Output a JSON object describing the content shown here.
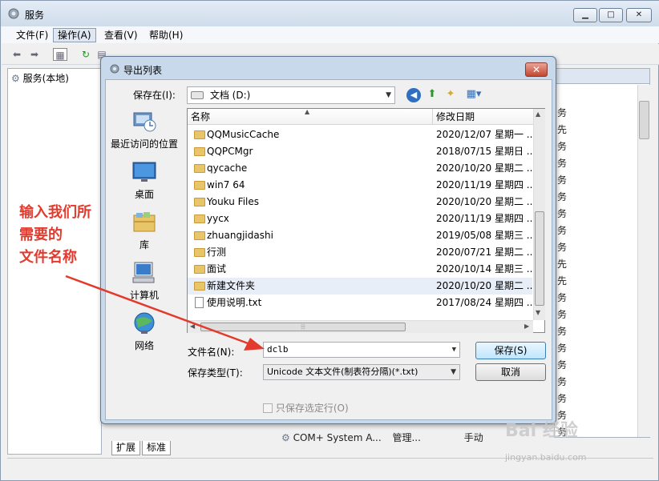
{
  "main_window": {
    "title": "服务",
    "controls": {
      "minimize": "▁",
      "maximize": "□",
      "close": "✕"
    },
    "menu": [
      "文件(F)",
      "操作(A)",
      "查看(V)",
      "帮助(H)"
    ],
    "active_menu_index": 1,
    "tree_item": "服务(本地)",
    "right_column_chars": [
      "务",
      "先",
      "务",
      "务",
      "务",
      "务",
      "务",
      "务",
      "务",
      "先",
      "先",
      "务",
      "务",
      "务",
      "务",
      "务",
      "务",
      "务",
      "务",
      "务"
    ],
    "bottom_tabs": [
      "扩展",
      "标准"
    ],
    "partial_row": {
      "name": "COM+ System A...",
      "desc": "管理...",
      "startup": "手动"
    }
  },
  "dialog": {
    "title": "导出列表",
    "close": "✕",
    "save_in_label": "保存在(I):",
    "save_in_value": "文档 (D:)",
    "places": [
      {
        "label": "最近访问的位置",
        "icon": "recent-places-icon"
      },
      {
        "label": "桌面",
        "icon": "desktop-icon"
      },
      {
        "label": "库",
        "icon": "library-icon"
      },
      {
        "label": "计算机",
        "icon": "computer-icon"
      },
      {
        "label": "网络",
        "icon": "network-icon"
      }
    ],
    "columns": {
      "name": "名称",
      "date": "修改日期"
    },
    "files": [
      {
        "name": "QQMusicCache",
        "date": "2020/12/07 星期一 ...",
        "type": "folder"
      },
      {
        "name": "QQPCMgr",
        "date": "2018/07/15 星期日 ...",
        "type": "folder"
      },
      {
        "name": "qycache",
        "date": "2020/10/20 星期二 ...",
        "type": "folder"
      },
      {
        "name": "win7 64",
        "date": "2020/11/19 星期四 ...",
        "type": "folder"
      },
      {
        "name": "Youku Files",
        "date": "2020/10/20 星期二 ...",
        "type": "folder"
      },
      {
        "name": "yycx",
        "date": "2020/11/19 星期四 ...",
        "type": "folder"
      },
      {
        "name": "zhuangjidashi",
        "date": "2019/05/08 星期三 ...",
        "type": "folder"
      },
      {
        "name": "行测",
        "date": "2020/07/21 星期二 ...",
        "type": "folder"
      },
      {
        "name": "面试",
        "date": "2020/10/14 星期三 ...",
        "type": "folder"
      },
      {
        "name": "新建文件夹",
        "date": "2020/10/20 星期二 ...",
        "type": "folder"
      },
      {
        "name": "使用说明.txt",
        "date": "2017/08/24 星期四 ...",
        "type": "file"
      }
    ],
    "selected_index": 9,
    "hscroll_grip": "⦙⦙⦙",
    "filename_label": "文件名(N):",
    "filename_value": "dclb",
    "filetype_label": "保存类型(T):",
    "filetype_value": "Unicode 文本文件(制表符分隔)(*.txt)",
    "save_button": "保存(S)",
    "cancel_button": "取消",
    "save_selected_only": "只保存选定行(O)"
  },
  "annotation": "输入我们所\n需要的\n文件名称",
  "watermark": {
    "main": "Bai 经验",
    "sub": "jingyan.baidu.com"
  },
  "colors": {
    "annotation": "#e23b2e",
    "selection": "#e8eef7",
    "dialog_frame": "#c9d9ec"
  }
}
